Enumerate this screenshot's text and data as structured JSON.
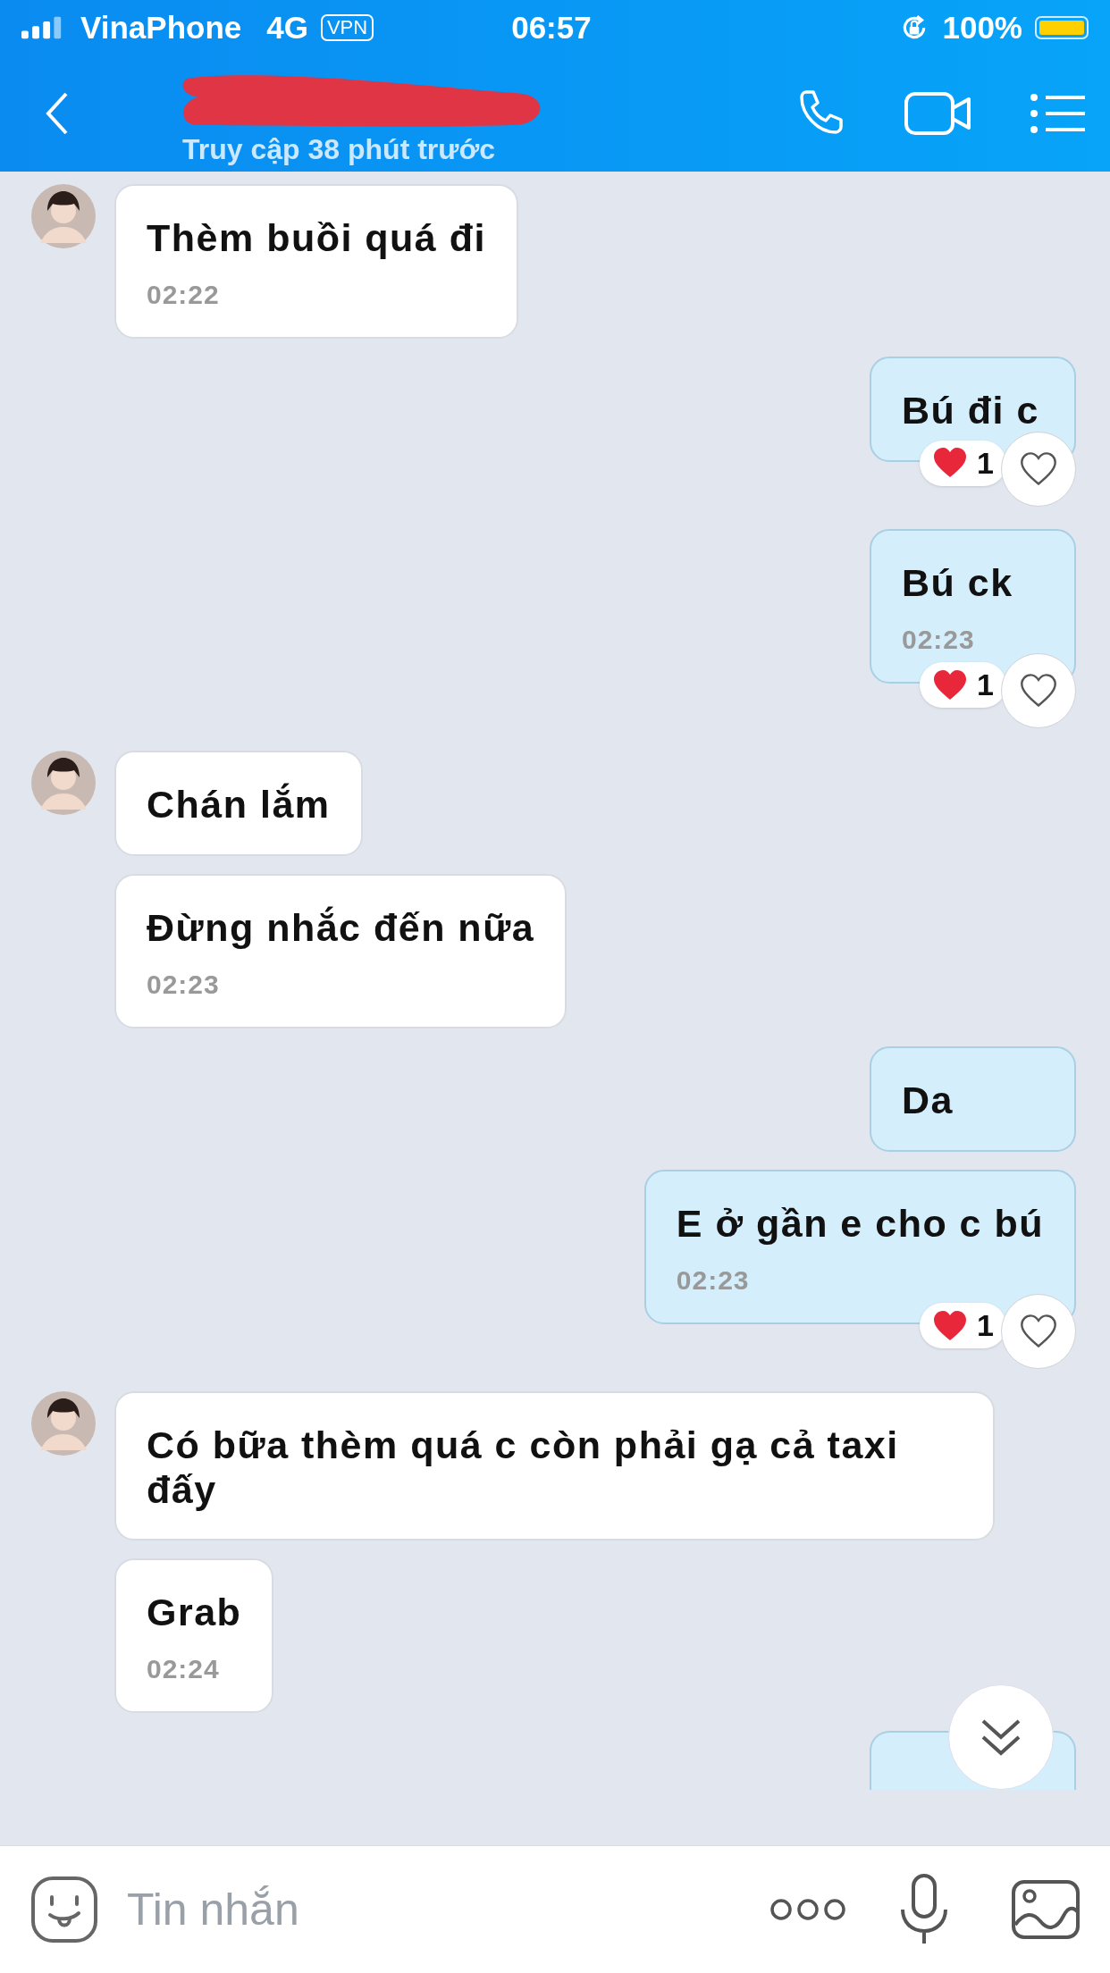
{
  "status_bar": {
    "carrier": "VinaPhone",
    "network": "4G",
    "vpn": "VPN",
    "time": "06:57",
    "battery": "100%"
  },
  "header": {
    "subtitle": "Truy cập 38 phút trước"
  },
  "messages": [
    {
      "kind": "in",
      "avatar": true,
      "text": "Thèm buồi quá đi",
      "time": "02:22"
    },
    {
      "kind": "out",
      "text": "Bú đi c",
      "reaction": "1"
    },
    {
      "kind": "out",
      "text": "Bú ck",
      "time": "02:23",
      "reaction": "1"
    },
    {
      "kind": "in",
      "avatar": true,
      "text": "Chán lắm"
    },
    {
      "kind": "in",
      "avatar": false,
      "text": "Đừng nhắc đến nữa",
      "time": "02:23"
    },
    {
      "kind": "out",
      "text": "Da"
    },
    {
      "kind": "out",
      "text": "E ở gần e cho c bú",
      "time": "02:23",
      "reaction": "1"
    },
    {
      "kind": "in",
      "avatar": true,
      "text": "Có bữa thèm quá c còn phải gạ cả taxi đấy"
    },
    {
      "kind": "in",
      "avatar": false,
      "text": "Grab",
      "time": "02:24"
    },
    {
      "kind": "out_partial"
    }
  ],
  "composer": {
    "placeholder": "Tin nhắn"
  }
}
